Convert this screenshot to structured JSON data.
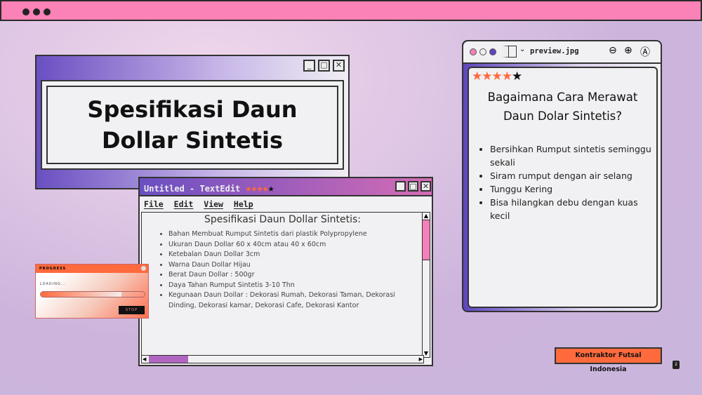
{
  "title_window": {
    "heading": "Spesifikasi Daun Dollar Sintetis"
  },
  "textedit": {
    "title": "Untitled - TextEdit",
    "rating": "4 of 5",
    "menu": [
      "File",
      "Edit",
      "View",
      "Help"
    ],
    "doc_title": "Spesifikasi Daun Dollar Sintetis:",
    "items": [
      "Bahan Membuat Rumput Sintetis dari plastik Polypropylene",
      "Ukuran Daun Dollar 60 x 40cm atau 40 x 60cm",
      "Ketebalan Daun Dollar 3cm",
      "Warna Daun Dollar Hijau",
      "Berat Daun Dollar : 500gr",
      "Daya Tahan Rumput Sintetis 3-10 Thn",
      "Kegunaan Daun Dollar : Dekorasi Rumah, Dekorasi Taman, Dekorasi Dinding, Dekorasi kamar, Dekorasi Cafe, Dekorasi Kantor"
    ]
  },
  "progress": {
    "title": "PROGRESS",
    "label": "LOADING...",
    "stop": "STOP",
    "value": 0.78
  },
  "preview": {
    "filename": "preview.jpg",
    "rating": "4 of 5",
    "heading": "Bagaimana Cara Merawat Daun Dolar Sintetis?",
    "items": [
      "Bersihkan Rumput sintetis seminggu sekali",
      "Siram rumput dengan air selang",
      "Tunggu Kering",
      "Bisa hilangkan debu dengan kuas kecil"
    ]
  },
  "footer": {
    "tag": "Kontraktor Futsal Indonesia",
    "page": "2"
  },
  "colors": {
    "accent": "#ff6a3d",
    "pink": "#fb82b6",
    "purple": "#6a4fc2"
  }
}
